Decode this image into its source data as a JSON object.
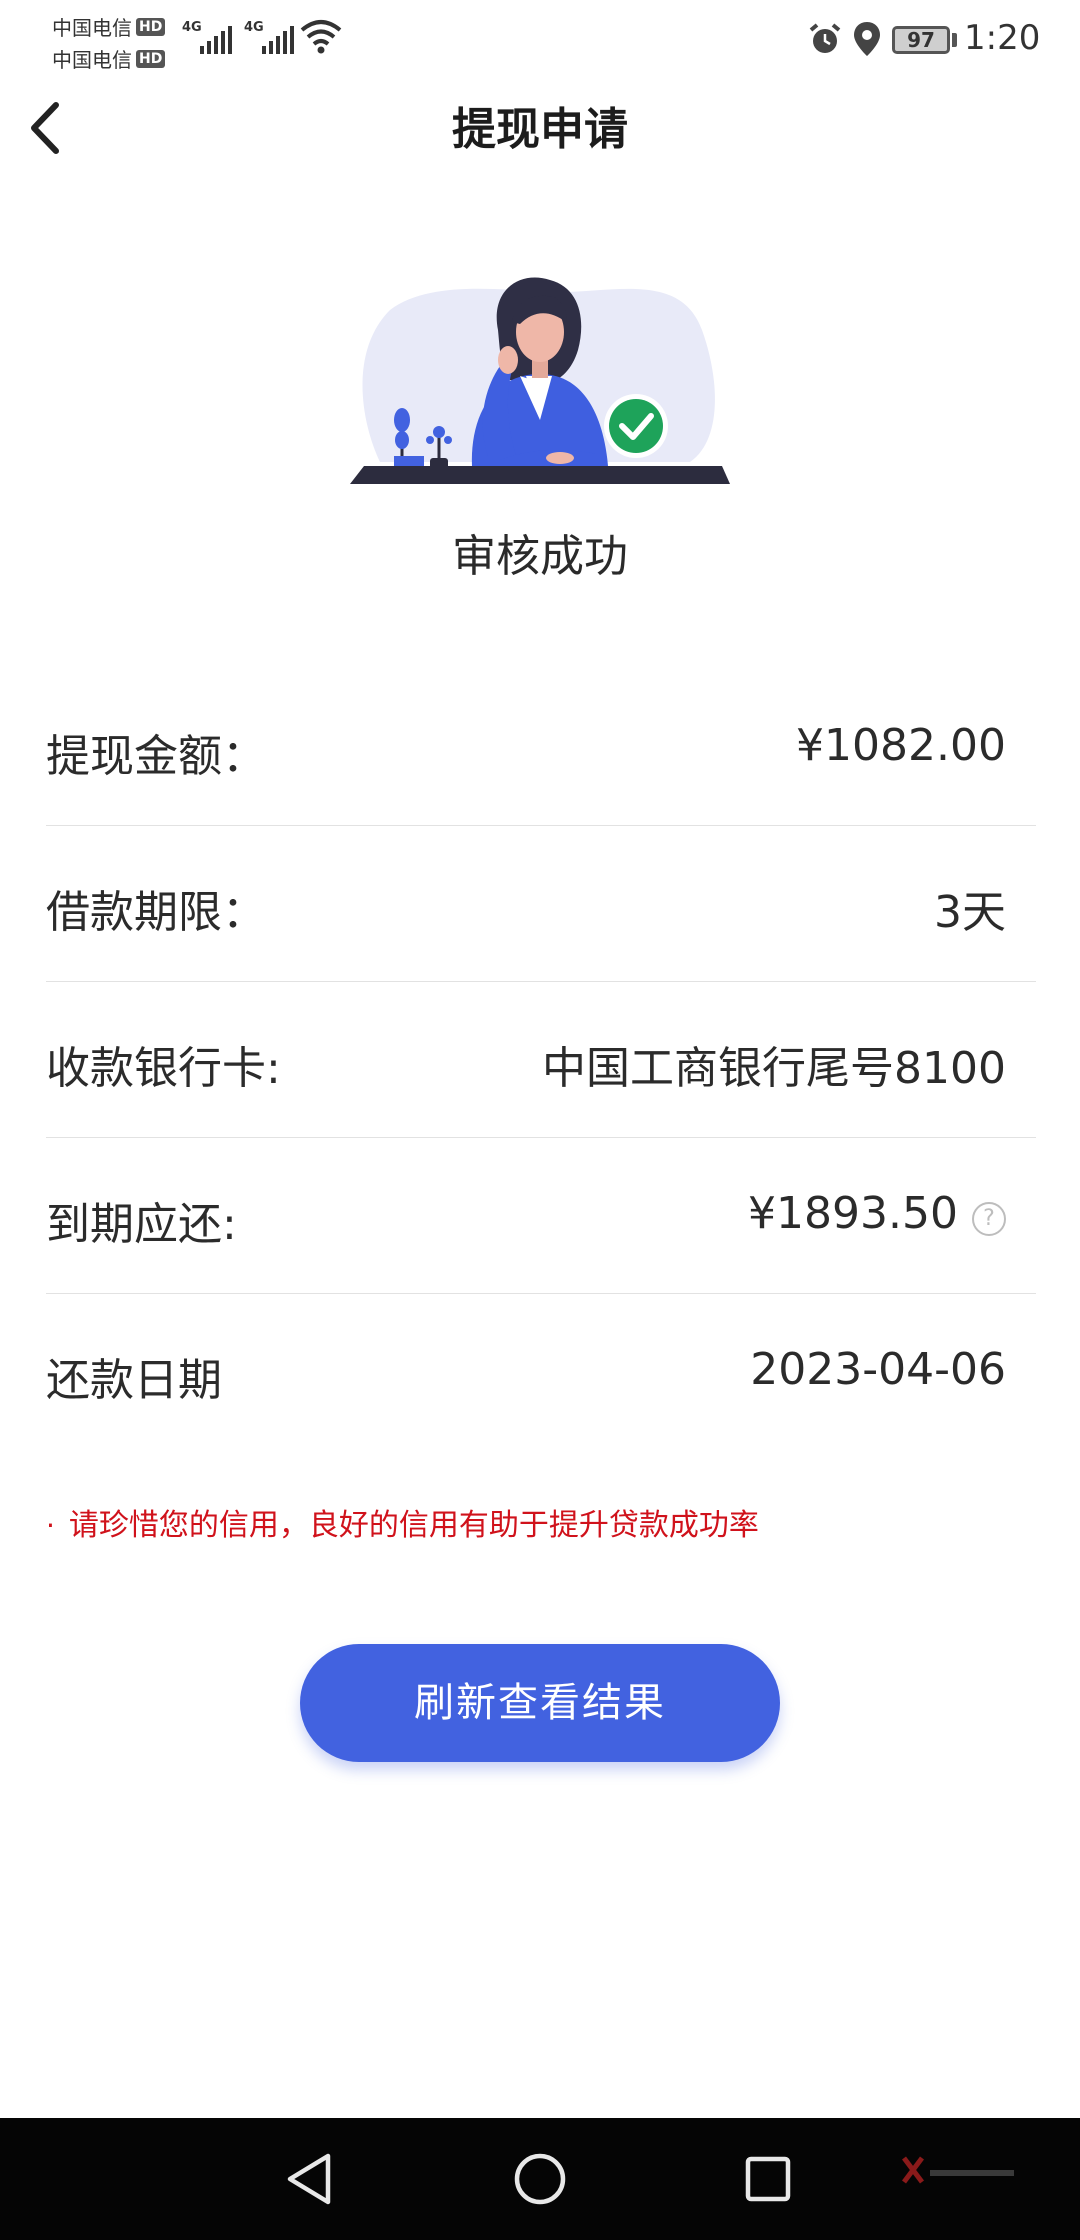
{
  "status_bar": {
    "carrier_1": "中国电信",
    "carrier_2": "中国电信",
    "hd_badge": "HD",
    "network_1": "4G",
    "network_2": "4G",
    "battery": "97",
    "time": "1:20",
    "icons": [
      "alarm-icon",
      "location-icon",
      "wifi-icon",
      "signal-icon"
    ]
  },
  "header": {
    "title": "提现申请",
    "back_icon": "chevron-left-icon"
  },
  "result": {
    "status_text": "审核成功",
    "illustration": "woman-at-desk-success-illustration"
  },
  "details": [
    {
      "label": "提现金额：",
      "value": "¥1082.00"
    },
    {
      "label": "借款期限：",
      "value": "3天"
    },
    {
      "label": "收款银行卡:",
      "value": "中国工商银行尾号8100"
    },
    {
      "label": "到期应还:",
      "value": "¥1893.50",
      "help": "?"
    },
    {
      "label": "还款日期",
      "value": "2023-04-06"
    }
  ],
  "notice": {
    "bullet": "·",
    "text": "请珍惜您的信用，良好的信用有助于提升贷款成功率"
  },
  "refresh_button": {
    "label": "刷新查看结果"
  },
  "nav_bar": {
    "buttons": [
      "back-triangle-icon",
      "home-circle-icon",
      "recents-square-icon"
    ]
  },
  "colors": {
    "accent": "#4262e0",
    "notice_red": "#d0121b",
    "success_green": "#1ea35a",
    "divider": "#e2e2e2"
  }
}
